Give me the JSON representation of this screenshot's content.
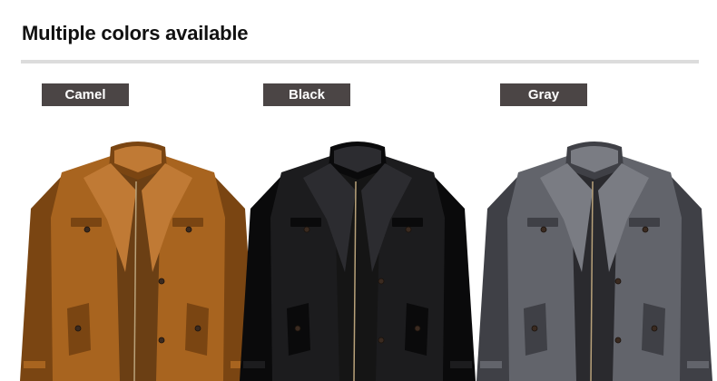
{
  "page": {
    "title": "Multiple colors available"
  },
  "variants": [
    {
      "label": "Camel",
      "label_bg": "#4b4545",
      "coat_color": "#a8641f",
      "coat_dark": "#7a4512",
      "coat_light": "#c07a35",
      "lining": "#6b3f14"
    },
    {
      "label": "Black",
      "label_bg": "#4b4545",
      "coat_color": "#1c1c1e",
      "coat_dark": "#0a0a0b",
      "coat_light": "#2c2c30",
      "lining": "#151515"
    },
    {
      "label": "Gray",
      "label_bg": "#4b4545",
      "coat_color": "#62646b",
      "coat_dark": "#3f4046",
      "coat_light": "#7a7c83",
      "lining": "#2a2a2e"
    }
  ]
}
